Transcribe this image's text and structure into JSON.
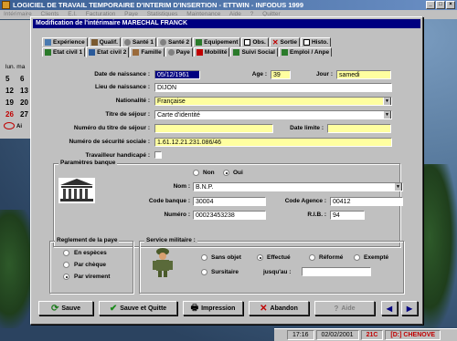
{
  "app": {
    "title": "LOGICIEL DE TRAVAIL TEMPORAIRE D'INTERIM D'INSERTION - ETTWIN - INFODUS 1999",
    "menu": [
      "Intérimaire",
      "Clients",
      "E.I.",
      "Facturation",
      "Paye",
      "Statistiques",
      "Maintenance",
      "Aide",
      "?",
      "Quitter"
    ]
  },
  "left_panel": {
    "day_headers": "lun. ma",
    "days": [
      "5",
      "12",
      "19",
      "26"
    ],
    "days_col2": [
      "6",
      "13",
      "20",
      "27"
    ],
    "extra": "Ai"
  },
  "dialog": {
    "title": "Modification de l'intérimaire MARECHAL FRANCK",
    "tabs_row1": [
      "Expérience",
      "Qualif.",
      "Santé 1",
      "Santé 2",
      "Equipement",
      "Obs.",
      "Sortie",
      "Histo."
    ],
    "tabs_row2": [
      "Etat civil 1",
      "Etat civil 2",
      "Famille",
      "Paye",
      "Mobilité",
      "Suivi Social",
      "Emploi / Anpe"
    ],
    "active_tab": "Etat civil 2",
    "fields": {
      "date_naissance_label": "Date de naissance :",
      "date_naissance": "05/12/1961",
      "age_label": "Age :",
      "age": "39",
      "jour_label": "Jour :",
      "jour": "samedi",
      "lieu_label": "Lieu de naissance :",
      "lieu": "DIJON",
      "nationalite_label": "Nationalité :",
      "nationalite": "Française",
      "titre_sejour_label": "Titre de séjour :",
      "titre_sejour": "Carte d'identité",
      "num_titre_label": "Numéro du titre de séjour :",
      "num_titre": "",
      "date_limite_label": "Date limite :",
      "date_limite": "",
      "secu_label": "Numéro de sécurité sociale :",
      "secu": "1.61.12.21.231.086/46",
      "handicape_label": "Travailleur handicapé :"
    },
    "banque": {
      "group_title": "Paramètres banque",
      "non_label": "Non",
      "oui_label": "Oui",
      "selected": "Oui",
      "nom_label": "Nom :",
      "nom": "B.N.P.",
      "code_banque_label": "Code banque :",
      "code_banque": "30004",
      "code_agence_label": "Code Agence :",
      "code_agence": "00412",
      "numero_label": "Numéro :",
      "numero": "00023453238",
      "rib_label": "R.I.B. :",
      "rib": "94"
    },
    "reglement": {
      "group_title": "Reglement de la paye",
      "options": [
        "En espèces",
        "Par chèque",
        "Par virement"
      ],
      "selected": "Par virement"
    },
    "service": {
      "group_title": "Service militaire :",
      "options": [
        "Sans objet",
        "Effectué",
        "Réformé",
        "Exempté",
        "Sursitaire"
      ],
      "selected": "Effectué",
      "jusquau_label": "jusqu'au :",
      "jusquau": ""
    },
    "buttons": {
      "sauve": "Sauve",
      "sauve_quitte": "Sauve et Quitte",
      "impression": "Impression",
      "abandon": "Abandon",
      "aide": "Aide"
    }
  },
  "taskbar": {
    "time": "17:16",
    "date": "02/02/2001",
    "code": "21C",
    "user": "[D:] CHENOVE"
  },
  "colors": {
    "title_bar": "#000080",
    "field_yellow": "#ffffa0",
    "dialog_bg": "#c0c0c0"
  }
}
